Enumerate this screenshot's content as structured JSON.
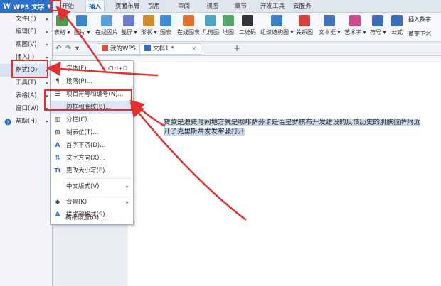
{
  "app": {
    "logo": "W",
    "title": "WPS 文字",
    "menu_arrow": "▼"
  },
  "tabs": [
    {
      "label": "开始"
    },
    {
      "label": "插入"
    },
    {
      "label": "页面布局"
    },
    {
      "label": "引用"
    },
    {
      "label": "审阅"
    },
    {
      "label": "视图"
    },
    {
      "label": "章节"
    },
    {
      "label": "开发工具"
    },
    {
      "label": "云服务"
    }
  ],
  "ribbon": [
    {
      "label": "表格 ▾",
      "color": "#4c9a52"
    },
    {
      "label": "图片 ▾",
      "color": "#3a86c8"
    },
    {
      "label": "在线图片",
      "color": "#5aa0d8"
    },
    {
      "label": "截屏 ▾",
      "color": "#6a7bd0"
    },
    {
      "label": "形状 ▾",
      "color": "#d28a2b"
    },
    {
      "label": "图表",
      "color": "#3f8ad6"
    },
    {
      "label": "在线图表",
      "color": "#e0702b"
    },
    {
      "label": "几何图",
      "color": "#4fa4c4"
    },
    {
      "label": "地图",
      "color": "#55a664"
    },
    {
      "label": "二维码",
      "color": "#333333"
    },
    {
      "label": "组织结构图 ▾",
      "color": "#3a7fc8"
    },
    {
      "label": "关系图",
      "color": "#d2443a"
    },
    {
      "label": "文本框 ▾",
      "color": "#4673b8"
    },
    {
      "label": "艺术字 ▾",
      "color": "#c94b8e"
    },
    {
      "label": "符号 ▾",
      "color": "#3a6fb8"
    },
    {
      "label": "公式",
      "color": "#3a6fb8"
    }
  ],
  "ribbon_right": [
    {
      "label": "插入数字"
    },
    {
      "label": "首字下沉"
    }
  ],
  "doc_tabs": [
    {
      "label": "我的WPS"
    },
    {
      "label": "文档1 *"
    }
  ],
  "wps_menu": [
    {
      "label": "文件(F)"
    },
    {
      "label": "编辑(E)"
    },
    {
      "label": "视图(V)"
    },
    {
      "label": "插入(I)"
    },
    {
      "label": "格式(O)"
    },
    {
      "label": "工具(T)"
    },
    {
      "label": "表格(A)"
    },
    {
      "label": "窗口(W)"
    },
    {
      "label": "帮助(H)"
    }
  ],
  "format_menu": [
    {
      "label": "字体(F)...",
      "shortcut": "Ctrl+D",
      "icon": "A"
    },
    {
      "label": "段落(P)...",
      "icon": "¶"
    },
    {
      "label": "项目符号和编号(N)...",
      "icon": "☰"
    },
    {
      "label": "边框和底纹(B)...",
      "icon": ""
    },
    {
      "label": "分栏(C)...",
      "icon": "▥"
    },
    {
      "label": "制表位(T)...",
      "icon": "⊞"
    },
    {
      "label": "首字下沉(D)...",
      "icon": "A"
    },
    {
      "label": "文字方向(X)...",
      "icon": "⇅"
    },
    {
      "label": "更改大小写(E)...",
      "icon": "Tt"
    },
    {
      "label": "中文版式(V)",
      "icon": ""
    },
    {
      "label": "背景(K)",
      "icon": "◆"
    },
    {
      "label": "样式和格式(S)...",
      "icon": "A"
    },
    {
      "label": "稿纸设置(G)...",
      "icon": ""
    }
  ],
  "document": {
    "text": "贷款是浪费时间地方就是咖啡萨芬卡是否星罗棋布开发建设的反馈历史的肌肤拉萨附近开了克里斯蒂发发牢骚打开"
  },
  "colors": {
    "accent": "#2a6fc9",
    "annotation_red": "#e0302f"
  }
}
